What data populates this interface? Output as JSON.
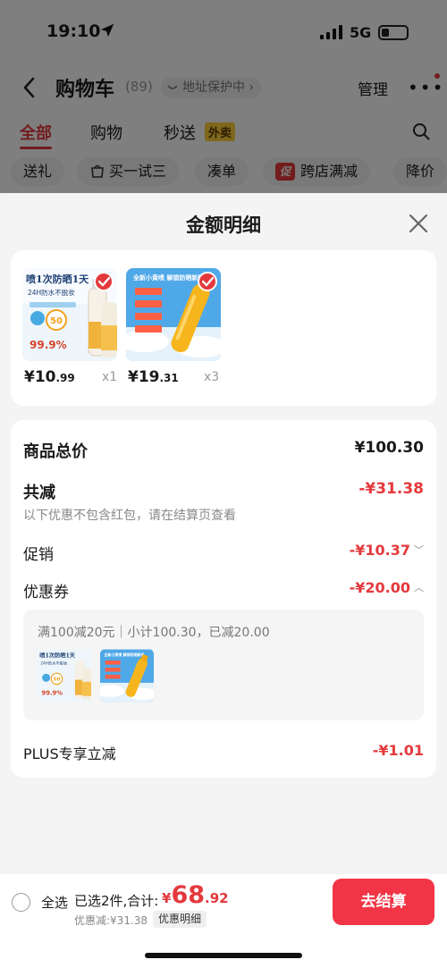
{
  "status": {
    "time": "19:10",
    "network": "5G"
  },
  "cart": {
    "title": "购物车",
    "count": "(89)",
    "address_protect": "地址保护中",
    "manage": "管理",
    "tabs": [
      {
        "label": "全部",
        "active": true
      },
      {
        "label": "购物"
      },
      {
        "label": "秒送",
        "badge": "外卖"
      }
    ],
    "filters": [
      "送礼",
      "买一试三",
      "凑单",
      "跨店满减",
      "降价"
    ],
    "promo_badge": "促"
  },
  "sheet": {
    "title": "金额明细",
    "products": [
      {
        "price_int": "¥10",
        "price_dec": ".99",
        "qty": "x1",
        "image": {
          "headline": "喷1次防晒1天",
          "sub": "24H防水不脱妆",
          "spf": "50",
          "percent": "99.9%"
        }
      },
      {
        "price_int": "¥19",
        "price_dec": ".31",
        "qty": "x3",
        "image": {
          "headline": "全新小黄喷 解锁防晒新知"
        }
      }
    ],
    "summary": {
      "subtotal_label": "商品总价",
      "subtotal_value": "¥100.30",
      "total_discount_label": "共减",
      "total_discount_value": "-¥31.38",
      "note": "以下优惠不包含红包，请在结算页查看",
      "promo_label": "促销",
      "promo_value": "-¥10.37",
      "coupon_label": "优惠券",
      "coupon_value": "-¥20.00",
      "coupon_desc": "满100减20元｜小计100.30，已减20.00",
      "plus_label": "PLUS专享立减",
      "plus_value": "-¥1.01"
    }
  },
  "bottom": {
    "select_all": "全选",
    "selected": "已选2件,合计:",
    "currency": "¥",
    "total_int": "68",
    "total_dec": ".92",
    "discount": "优惠减:¥31.38",
    "detail_chip": "优惠明细",
    "checkout": "去结算"
  },
  "colors": {
    "accent": "#e4393c",
    "checkout": "#f23546"
  }
}
